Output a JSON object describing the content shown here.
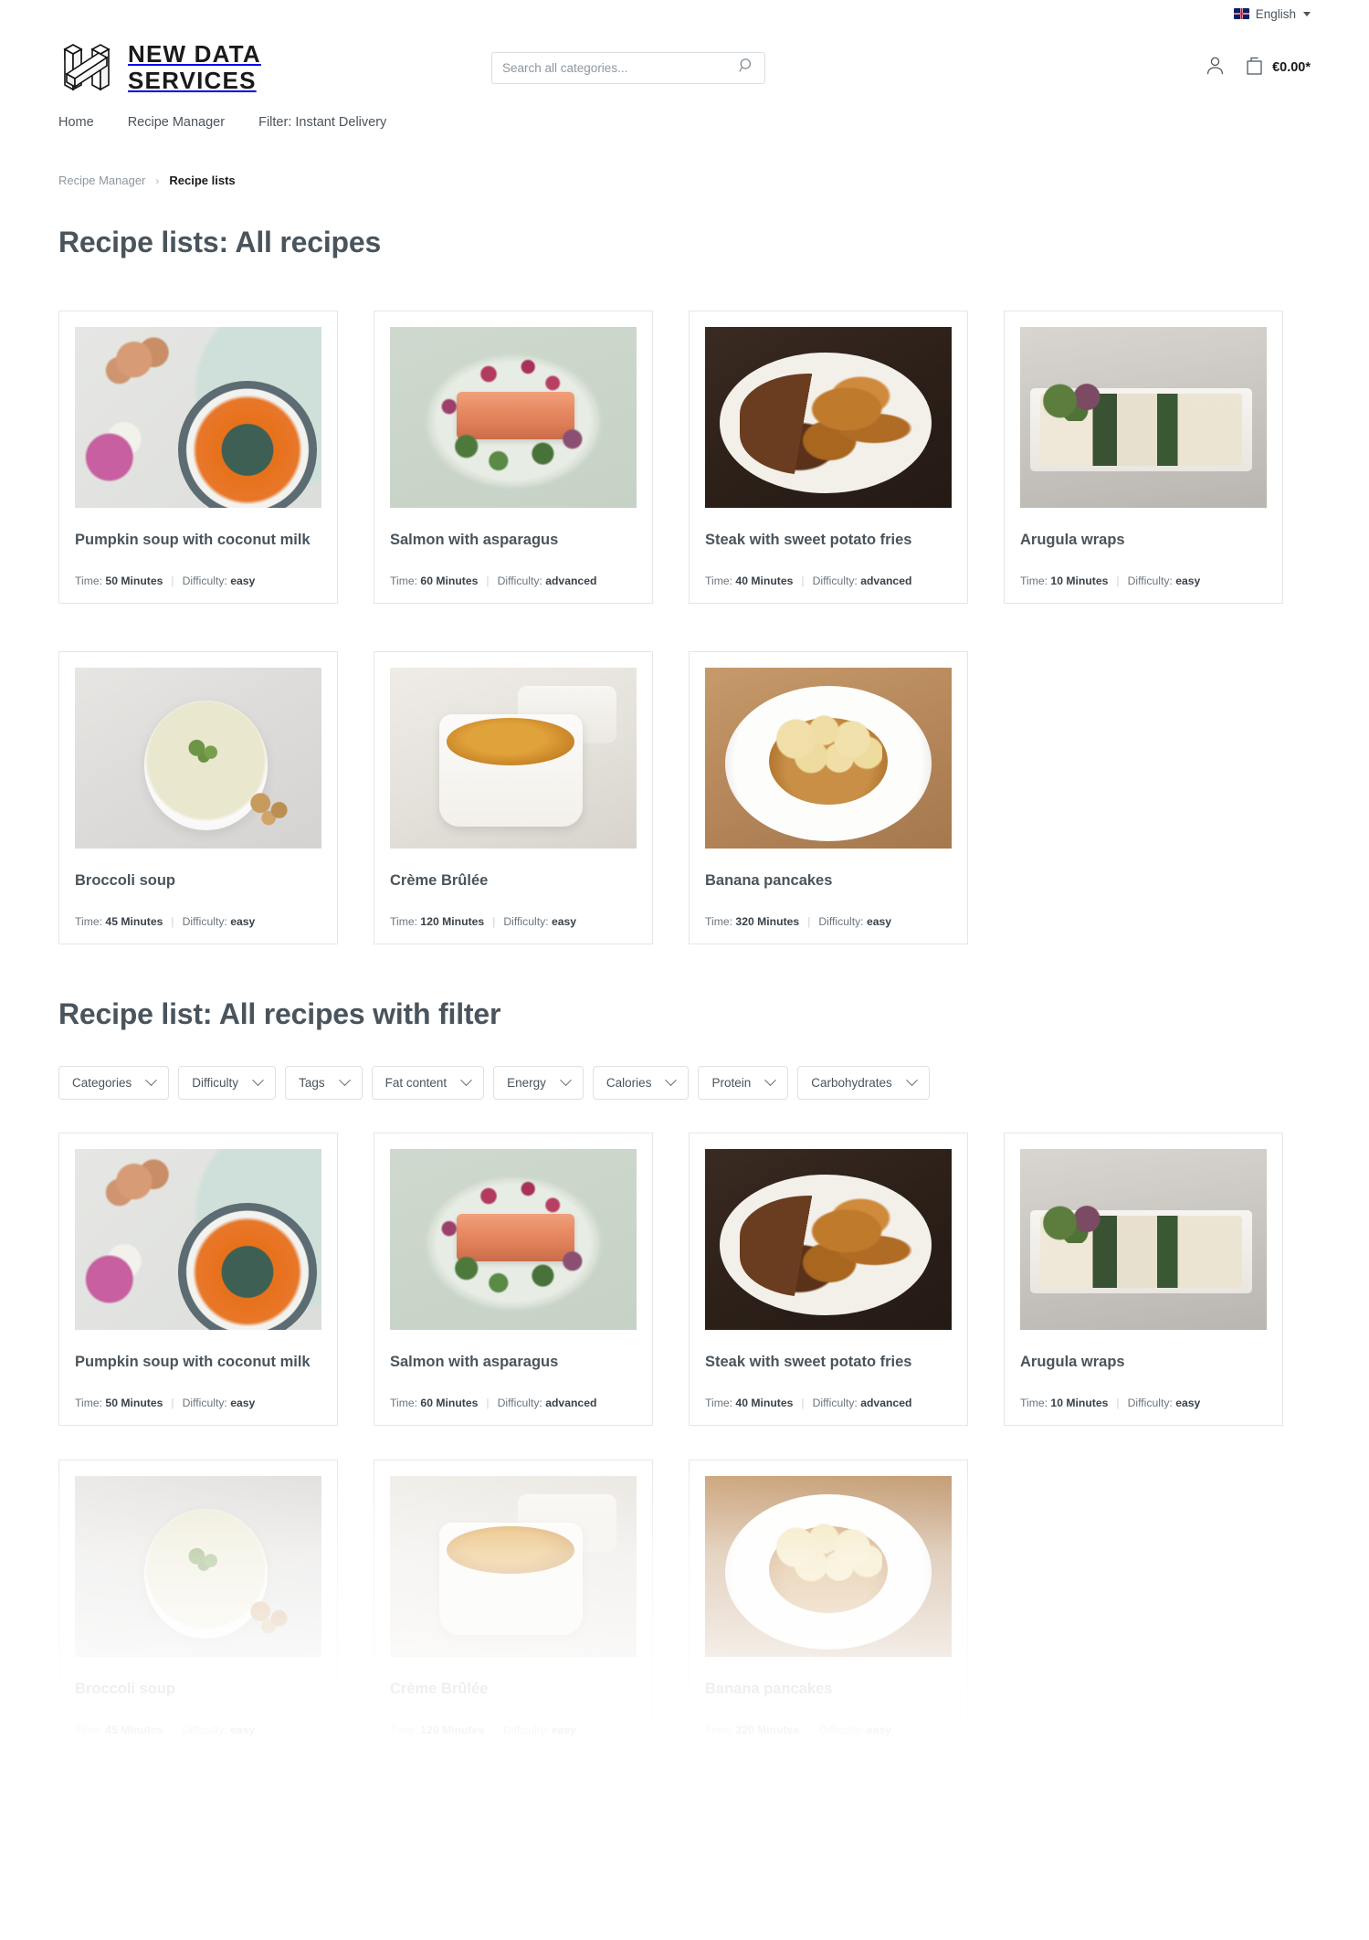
{
  "topbar": {
    "language_label": "English",
    "flag_icon": "uk-flag-icon",
    "caret_icon": "caret-down-icon"
  },
  "header": {
    "logo_line1": "NEW DATA",
    "logo_line2": "SERVICES",
    "logo_mark": "isometric-h-logo",
    "search": {
      "placeholder": "Search all categories...",
      "value": "",
      "icon": "search-icon"
    },
    "account_icon": "user-icon",
    "cart_icon": "shopping-bag-icon",
    "cart_total": "€0.00*"
  },
  "mainnav": {
    "items": [
      {
        "label": "Home"
      },
      {
        "label": "Recipe Manager"
      },
      {
        "label": "Filter: Instant Delivery"
      }
    ]
  },
  "breadcrumb": {
    "parent": "Recipe Manager",
    "separator": "›",
    "current": "Recipe lists"
  },
  "sections": [
    {
      "title": "Recipe lists: All recipes",
      "has_filters": false
    },
    {
      "title": "Recipe list: All recipes with filter",
      "has_filters": true
    }
  ],
  "filters": [
    {
      "label": "Categories",
      "icon": "chevron-down-icon"
    },
    {
      "label": "Difficulty",
      "icon": "chevron-down-icon"
    },
    {
      "label": "Tags",
      "icon": "chevron-down-icon"
    },
    {
      "label": "Fat content",
      "icon": "chevron-down-icon"
    },
    {
      "label": "Energy",
      "icon": "chevron-down-icon"
    },
    {
      "label": "Calories",
      "icon": "chevron-down-icon"
    },
    {
      "label": "Protein",
      "icon": "chevron-down-icon"
    },
    {
      "label": "Carbohydrates",
      "icon": "chevron-down-icon"
    }
  ],
  "meta_labels": {
    "time_prefix": "Time:",
    "difficulty_prefix": "Difficulty:",
    "divider": "|"
  },
  "recipes": [
    {
      "title": "Pumpkin soup with coconut milk",
      "time": "50 Minutes",
      "difficulty": "easy",
      "image": "pumpkin-soup-photo"
    },
    {
      "title": "Salmon with asparagus",
      "time": "60 Minutes",
      "difficulty": "advanced",
      "image": "salmon-asparagus-photo"
    },
    {
      "title": "Steak with sweet potato fries",
      "time": "40 Minutes",
      "difficulty": "advanced",
      "image": "steak-fries-photo"
    },
    {
      "title": "Arugula wraps",
      "time": "10 Minutes",
      "difficulty": "easy",
      "image": "arugula-wraps-photo"
    },
    {
      "title": "Broccoli soup",
      "time": "45 Minutes",
      "difficulty": "easy",
      "image": "broccoli-soup-photo"
    },
    {
      "title": "Crème Brûlée",
      "time": "120 Minutes",
      "difficulty": "easy",
      "image": "creme-brulee-photo"
    },
    {
      "title": "Banana pancakes",
      "time": "320 Minutes",
      "difficulty": "easy",
      "image": "banana-pancakes-photo"
    }
  ],
  "colors": {
    "heading": "#4a545c",
    "body_text": "#6b757e",
    "border": "#e3e7ea",
    "accent_dark": "#1a1a1a"
  }
}
